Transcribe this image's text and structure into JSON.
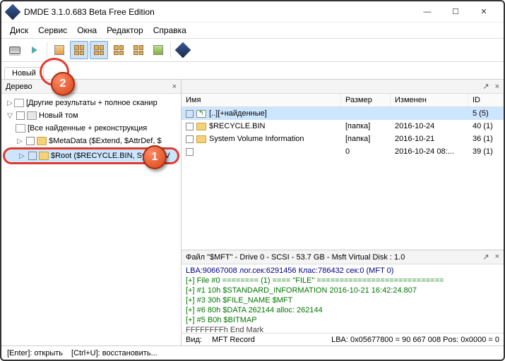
{
  "window": {
    "title": "DMDE 3.1.0.683 Beta Free Edition"
  },
  "menu": {
    "disk": "Диск",
    "service": "Сервис",
    "windows": "Окна",
    "editor": "Редактор",
    "help": "Справка"
  },
  "tabs": {
    "main": "Новый"
  },
  "tree": {
    "title": "Дерево",
    "items": [
      {
        "label": "[Другие результаты + полное сканир"
      },
      {
        "label": "Новый том"
      },
      {
        "label": "[Все найденные + реконструкция"
      },
      {
        "label": "$MetaData ($Extend, $AttrDef, $"
      },
      {
        "label": "$Root ($RECYCLE.BIN, System V"
      }
    ]
  },
  "columns": {
    "name": "Имя",
    "size": "Размер",
    "modified": "Изменен",
    "id": "ID"
  },
  "files": [
    {
      "name": "[..][+найденные]",
      "size": "",
      "mod": "",
      "id": "5 (5)",
      "sel": true,
      "up": true
    },
    {
      "name": "$RECYCLE.BIN",
      "size": "[папка]",
      "mod": "2016-10-24",
      "id": "40 (1)"
    },
    {
      "name": "System Volume Information",
      "size": "[папка]",
      "mod": "2016-10-21",
      "id": "36 (1)"
    },
    {
      "name": "",
      "size": "0",
      "mod": "2016-10-24 08:...",
      "id": "39 (1)"
    }
  ],
  "hex": {
    "title": "Файл \"$MFT\" - Drive 0 - SCSI - 53.7 GB - Msft Virtual Disk : 1.0",
    "lines": [
      "LBA:90667008                лог.сек:6291456 Клас:786432 cек:0 (MFT 0)",
      "[+] File #0 ======== (1) ==== \"FILE\" ============================",
      "[+] #1        10h $STANDARD_INFORMATION   2016-10-21 16:42:24.807",
      "[+] #3        30h $FILE_NAME $MFT",
      "[+] #6        80h $DATA         262144           alloc: 262144",
      "[+] #5        B0h $BITMAP",
      "            FFFFFFFFh End Mark"
    ],
    "footer_view": "Вид:",
    "footer_mft": "MFT Record",
    "footer_lba": "LBA: 0x05677800 = 90 667 008  Pos: 0x0000 = 0"
  },
  "status": {
    "enter": "[Enter]: открыть",
    "ctrlU": "[Ctrl+U]: восстановить..."
  },
  "callouts": {
    "c1": "1",
    "c2": "2"
  }
}
